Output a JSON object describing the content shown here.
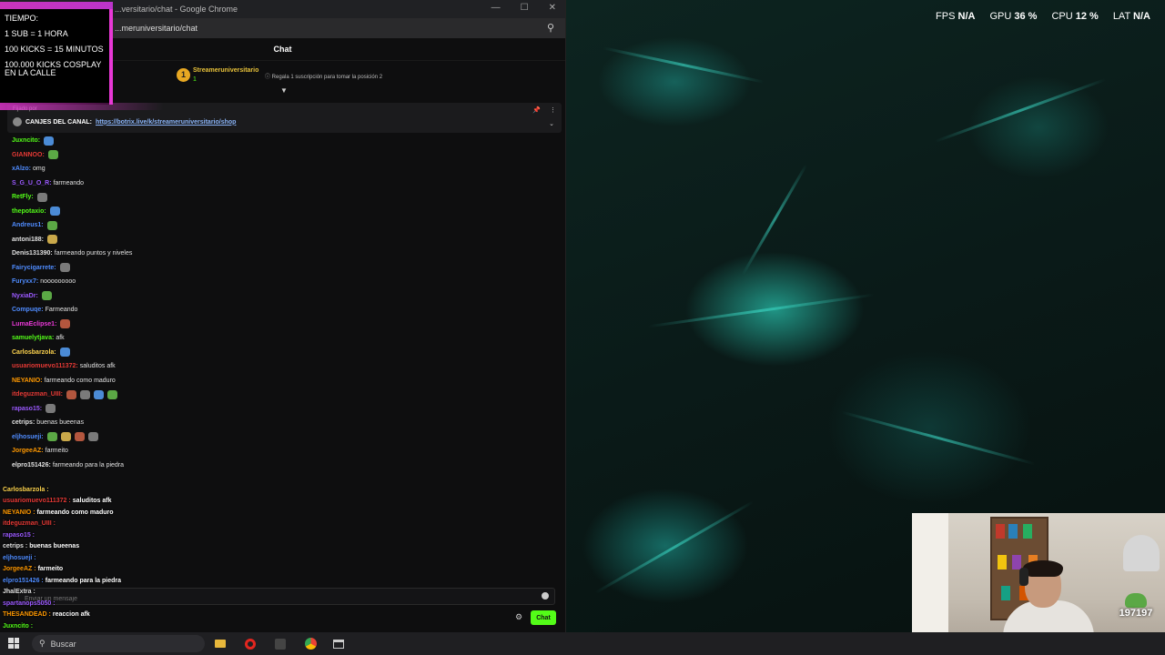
{
  "stats": {
    "fps_label": "FPS",
    "fps_value": "N/A",
    "gpu_label": "GPU",
    "gpu_value": "36 %",
    "cpu_label": "CPU",
    "cpu_value": "12 %",
    "lat_label": "LAT",
    "lat_value": "N/A"
  },
  "chrome": {
    "title": "...versitario/chat - Google Chrome",
    "address": "...meruniversitario/chat"
  },
  "chat": {
    "header": "Chat",
    "gift_user": "Streameruniversitario",
    "gift_count": "1",
    "gift_rule": "Regala 1 suscripción para tomar la posición 2",
    "pinned_by": "Fijado por",
    "pinned_label": "CANJES DEL CANAL:",
    "pinned_link": "https://botrix.live/k/streameruniversitario/shop",
    "input_placeholder": "Enviar un mensaje",
    "send_label": "Chat",
    "colors": {
      "accent": "#53fc18",
      "pink": "#e838d6"
    },
    "messages": [
      {
        "user": "Juxncito:",
        "text": "",
        "color": "#53fc18",
        "emotes": 1
      },
      {
        "user": "GIANNOO:",
        "text": "",
        "color": "#e53935",
        "emotes": 1
      },
      {
        "user": "xAlzo:",
        "text": "omg",
        "color": "#4f8cff",
        "emotes": 0
      },
      {
        "user": "S_G_U_O_R:",
        "text": "farmeando",
        "color": "#9b59ff",
        "emotes": 0
      },
      {
        "user": "RetFly:",
        "text": "",
        "color": "#53fc18",
        "emotes": 1
      },
      {
        "user": "thepotaxio:",
        "text": "",
        "color": "#53fc18",
        "emotes": 1
      },
      {
        "user": "Andreus1:",
        "text": "",
        "color": "#4f8cff",
        "emotes": 1
      },
      {
        "user": "antoni188:",
        "text": "",
        "color": "#e0e0e0",
        "emotes": 1
      },
      {
        "user": "Denis131390:",
        "text": "farmeando puntos y niveles",
        "color": "#e0e0e0",
        "emotes": 0
      },
      {
        "user": "Fairycigarrete:",
        "text": "",
        "color": "#4f8cff",
        "emotes": 1
      },
      {
        "user": "Furyxx7:",
        "text": "nooooooooo",
        "color": "#4f8cff",
        "emotes": 0
      },
      {
        "user": "NyxiaDr:",
        "text": "",
        "color": "#9b59ff",
        "emotes": 1
      },
      {
        "user": "Compuqe:",
        "text": "Farmeando",
        "color": "#4f8cff",
        "emotes": 0
      },
      {
        "user": "LumaEclipse1:",
        "text": "",
        "color": "#e838d6",
        "emotes": 1
      },
      {
        "user": "samuelytjava:",
        "text": "afk",
        "color": "#53fc18",
        "emotes": 0
      },
      {
        "user": "Carlosbarzola:",
        "text": "",
        "color": "#ffd54f",
        "emotes": 1
      },
      {
        "user": "usuariomuevo111372:",
        "text": "saluditos afk",
        "color": "#e53935",
        "emotes": 0
      },
      {
        "user": "NEYANIO:",
        "text": "farmeando como maduro",
        "color": "#ff9800",
        "emotes": 0
      },
      {
        "user": "itdeguzman_UIII:",
        "text": "",
        "color": "#e53935",
        "emotes": 4
      },
      {
        "user": "rapaso15:",
        "text": "",
        "color": "#9b59ff",
        "emotes": 1
      },
      {
        "user": "cetrips:",
        "text": "buenas bueenas",
        "color": "#e0e0e0",
        "emotes": 0
      },
      {
        "user": "eljhosueji:",
        "text": "",
        "color": "#4f8cff",
        "emotes": 4
      },
      {
        "user": "JorgeeAZ:",
        "text": "farmeito",
        "color": "#ff9800",
        "emotes": 0
      },
      {
        "user": "elpro151426:",
        "text": "farmeando para la piedra",
        "color": "#e0e0e0",
        "emotes": 0
      }
    ]
  },
  "overlay_chat": [
    {
      "user": "Carlosbarzola :",
      "text": "",
      "color": "#ffd54f"
    },
    {
      "user": "usuariomuevo111372 :",
      "text": "saluditos afk",
      "color": "#e53935"
    },
    {
      "user": "NEYANIO :",
      "text": "farmeando como maduro",
      "color": "#ff9800"
    },
    {
      "user": "itdeguzman_UIII :",
      "text": "",
      "color": "#e53935"
    },
    {
      "user": "rapaso15 :",
      "text": "",
      "color": "#9b59ff"
    },
    {
      "user": "cetrips :",
      "text": "buenas bueenas",
      "color": "#e0e0e0"
    },
    {
      "user": "eljhosueji :",
      "text": "",
      "color": "#4f8cff"
    },
    {
      "user": "JorgeeAZ :",
      "text": "farmeito",
      "color": "#ff9800"
    },
    {
      "user": "elpro151426 :",
      "text": "farmeando para la piedra",
      "color": "#4f8cff"
    },
    {
      "user": "JhalExtra :",
      "text": "",
      "color": "#e0e0e0"
    },
    {
      "user": "spartanops5050 :",
      "text": "",
      "color": "#9b59ff"
    },
    {
      "user": "THESANDEAD :",
      "text": "reaccion afk",
      "color": "#ff9800"
    },
    {
      "user": "Juxncito :",
      "text": "",
      "color": "#53fc18"
    }
  ],
  "tiempo": {
    "title": "TIEMPO:",
    "line1": "1 SUB = 1 HORA",
    "line2": "100 KICKS = 15 MINUTOS",
    "line3": "100.000 KICKS COSPLAY EN LA CALLE"
  },
  "webcam": {
    "sub_count": "197197"
  },
  "taskbar": {
    "search_placeholder": "Buscar",
    "apps": [
      "files-icon",
      "opera-icon",
      "app-icon",
      "chrome-icon",
      "window-icon"
    ]
  }
}
